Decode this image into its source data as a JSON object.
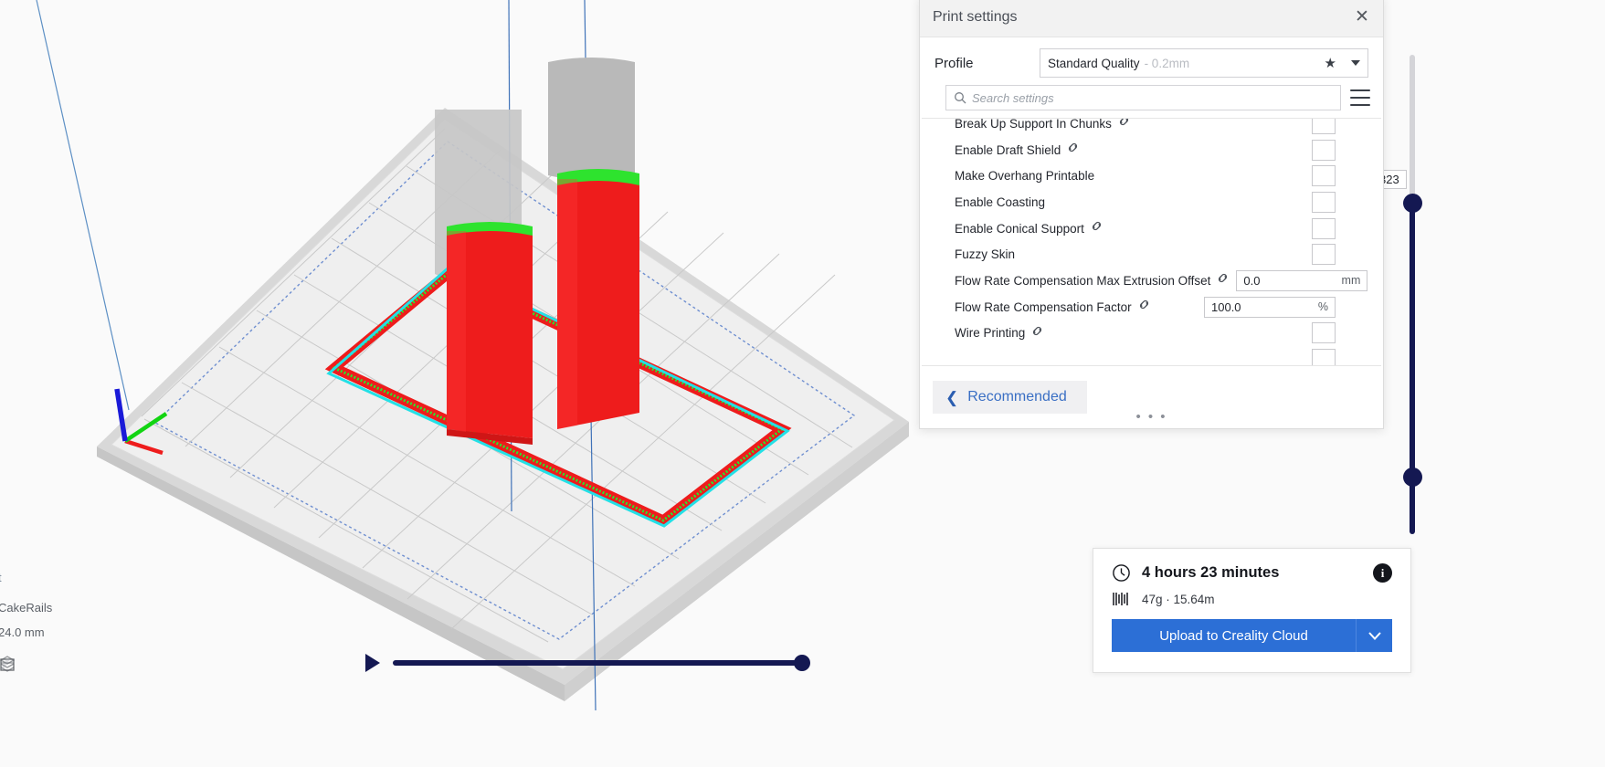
{
  "viewport": {
    "object_name": "CakeRails",
    "object_height": "24.0 mm",
    "partial_label": "t",
    "play_icon": "play-icon",
    "bed_icons": [
      "layers-icon",
      "box-icon",
      "shaded-box-icon"
    ]
  },
  "layer_slider": {
    "value": "323",
    "name": "layer-view-slider"
  },
  "settings_panel": {
    "title": "Print settings",
    "close_icon": "close-icon",
    "profile_label": "Profile",
    "profile_name": "Standard Quality",
    "profile_variant": "- 0.2mm",
    "star_icon": "★",
    "caret_icon": "chevron-down-icon",
    "search_placeholder": "Search settings",
    "search_value": "",
    "menu_icon": "hamburger-menu-icon",
    "rows": [
      {
        "label": "Break Up Support In Chunks",
        "linked": true,
        "type": "checkbox",
        "value": "",
        "unit": ""
      },
      {
        "label": "Enable Draft Shield",
        "linked": true,
        "type": "checkbox",
        "value": "",
        "unit": ""
      },
      {
        "label": "Make Overhang Printable",
        "linked": false,
        "type": "checkbox",
        "value": "",
        "unit": ""
      },
      {
        "label": "Enable Coasting",
        "linked": false,
        "type": "checkbox",
        "value": "",
        "unit": ""
      },
      {
        "label": "Enable Conical Support",
        "linked": true,
        "type": "checkbox",
        "value": "",
        "unit": ""
      },
      {
        "label": "Fuzzy Skin",
        "linked": false,
        "type": "checkbox",
        "value": "",
        "unit": ""
      },
      {
        "label": "Flow Rate Compensation Max Extrusion Offset",
        "linked": true,
        "type": "field",
        "value": "0.0",
        "unit": "mm"
      },
      {
        "label": "Flow Rate Compensation Factor",
        "linked": true,
        "type": "field",
        "value": "100.0",
        "unit": "%"
      },
      {
        "label": "Wire Printing",
        "linked": true,
        "type": "checkbox",
        "value": "",
        "unit": ""
      }
    ],
    "recommended_label": "Recommended",
    "recommended_chevron": "chevron-left-icon",
    "grip": "• • •"
  },
  "estimate": {
    "clock_icon": "clock-icon",
    "time": "4 hours 23 minutes",
    "info_icon": "info-icon",
    "spool_icon": "filament-icon",
    "material": "47g · 15.64m",
    "upload_label": "Upload to Creality Cloud",
    "upload_caret": "chevron-down-icon",
    "accent_color": "#2c6fd6"
  }
}
